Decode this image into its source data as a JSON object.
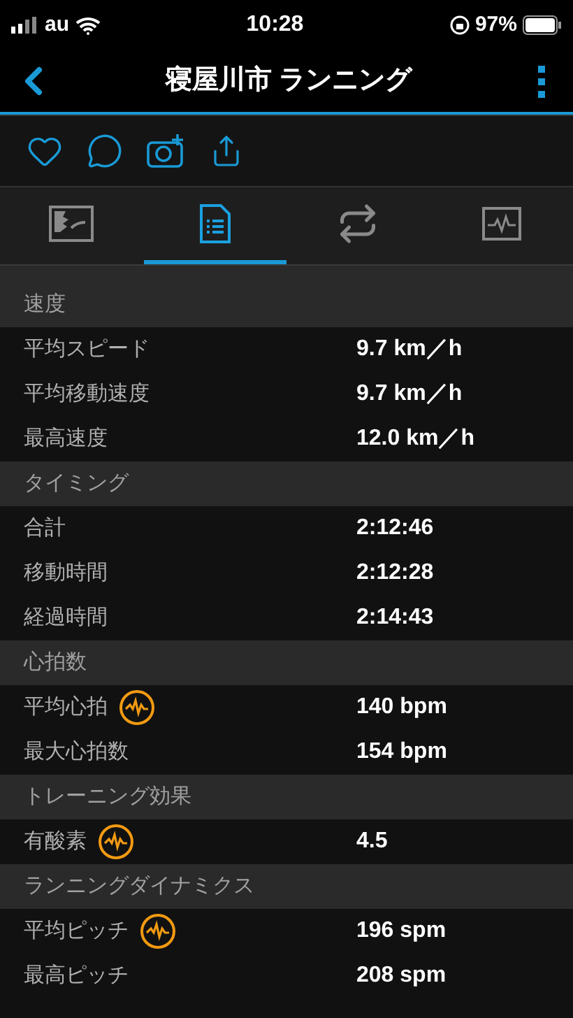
{
  "status_bar": {
    "carrier": "au",
    "time": "10:28",
    "battery": "97%"
  },
  "header": {
    "title": "寝屋川市 ランニング"
  },
  "tabs": [
    {
      "kind": "map",
      "selected": false
    },
    {
      "kind": "stats",
      "selected": true
    },
    {
      "kind": "laps",
      "selected": false
    },
    {
      "kind": "chart",
      "selected": false
    }
  ],
  "sections": [
    {
      "title": "速度",
      "rows": [
        {
          "kind": "plain",
          "label": "平均スピード",
          "value": "9.7 km／h"
        },
        {
          "kind": "plain",
          "label": "平均移動速度",
          "value": "9.7 km／h"
        },
        {
          "kind": "plain",
          "label": "最高速度",
          "value": "12.0 km／h"
        }
      ]
    },
    {
      "title": "タイミング",
      "rows": [
        {
          "kind": "plain",
          "label": "合計",
          "value": "2:12:46"
        },
        {
          "kind": "plain",
          "label": "移動時間",
          "value": "2:12:28"
        },
        {
          "kind": "plain",
          "label": "経過時間",
          "value": "2:14:43"
        }
      ]
    },
    {
      "title": "心拍数",
      "rows": [
        {
          "kind": "gauge",
          "label": "平均心拍",
          "value": "140 bpm"
        },
        {
          "kind": "plain",
          "label": "最大心拍数",
          "value": "154 bpm"
        }
      ]
    },
    {
      "title": "トレーニング効果",
      "rows": [
        {
          "kind": "gauge",
          "label": "有酸素",
          "value": "4.5"
        }
      ]
    },
    {
      "title": "ランニングダイナミクス",
      "rows": [
        {
          "kind": "gauge",
          "label": "平均ピッチ",
          "value": "196 spm"
        },
        {
          "kind": "plain",
          "label": "最高ピッチ",
          "value": "208 spm"
        }
      ]
    }
  ]
}
